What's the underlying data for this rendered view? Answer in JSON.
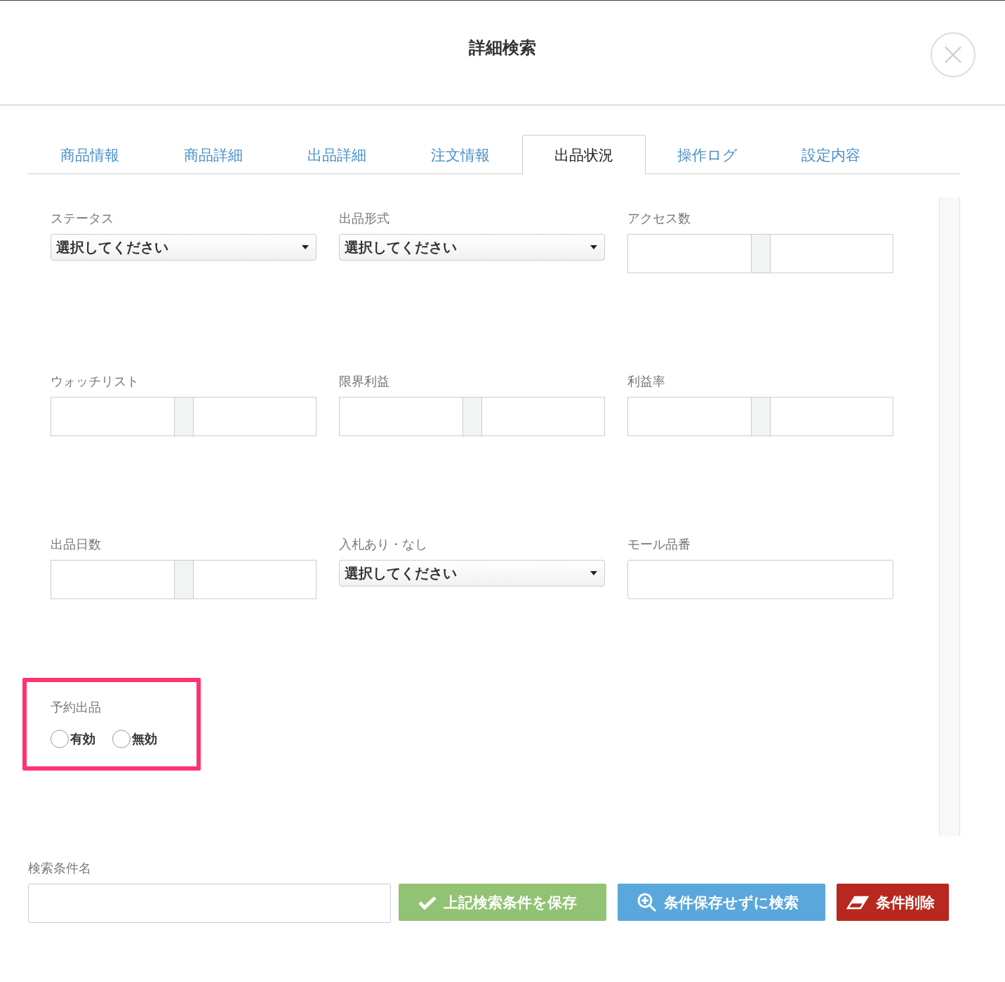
{
  "dialog": {
    "title": "詳細検索"
  },
  "tabs": [
    {
      "label": "商品情報",
      "selected": false
    },
    {
      "label": "商品詳細",
      "selected": false
    },
    {
      "label": "出品詳細",
      "selected": false
    },
    {
      "label": "注文情報",
      "selected": false
    },
    {
      "label": "出品状況",
      "selected": true
    },
    {
      "label": "操作ログ",
      "selected": false
    },
    {
      "label": "設定内容",
      "selected": false
    }
  ],
  "fields": [
    {
      "label": "ステータス",
      "kind": "select",
      "value": "選択してください"
    },
    {
      "label": "出品形式",
      "kind": "select",
      "value": "選択してください"
    },
    {
      "label": "アクセス数",
      "kind": "range"
    },
    {
      "label": "ウォッチリスト",
      "kind": "range"
    },
    {
      "label": "限界利益",
      "kind": "range"
    },
    {
      "label": "利益率",
      "kind": "range"
    },
    {
      "label": "出品日数",
      "kind": "range"
    },
    {
      "label": "入札あり・なし",
      "kind": "select",
      "value": "選択してください"
    },
    {
      "label": "モール品番",
      "kind": "text"
    },
    {
      "label": "予約出品",
      "kind": "radio",
      "highlighted": true,
      "options": [
        {
          "label": "有効",
          "selected": false
        },
        {
          "label": "無効",
          "selected": false
        }
      ]
    }
  ],
  "search_name": {
    "label": "検索条件名"
  },
  "buttons": [
    {
      "label": "上記検索条件を保存",
      "kind": "save"
    },
    {
      "label": "条件保存せずに検索",
      "kind": "search"
    },
    {
      "label": "条件削除",
      "kind": "clear"
    }
  ]
}
